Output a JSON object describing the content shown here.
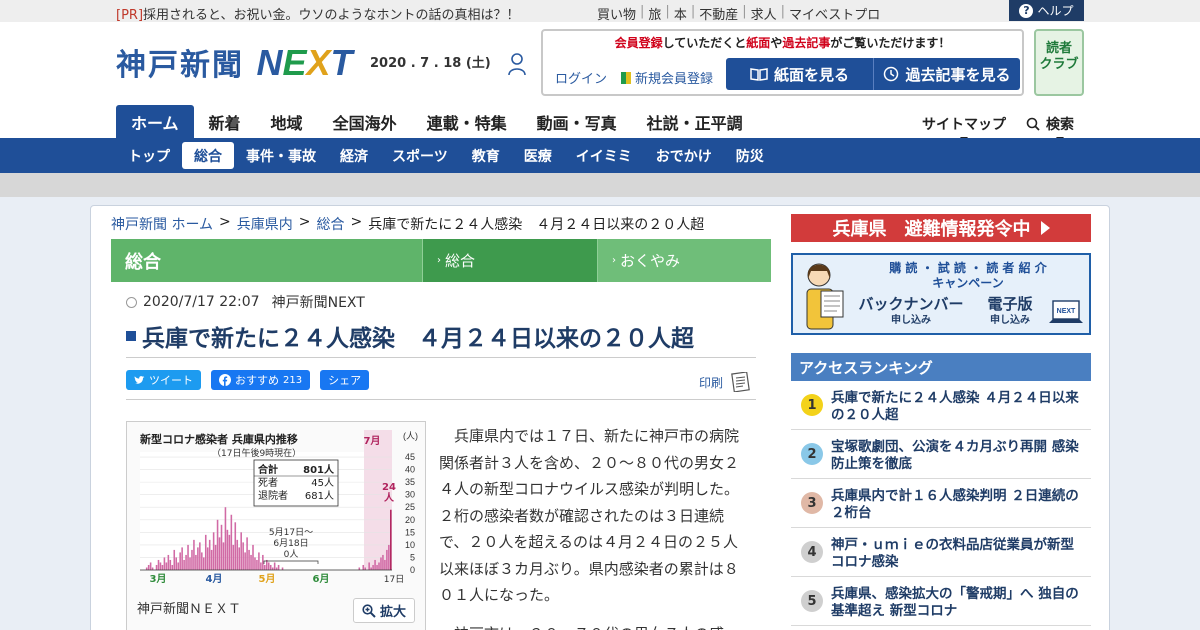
{
  "top_bar": {
    "pr_tag": "[PR]",
    "pr_text": "採用されると、お祝い金。ウソのようなホントの話の真相は？！",
    "links": [
      "買い物",
      "旅",
      "本",
      "不動産",
      "求人",
      "マイベストプロ"
    ],
    "help_label": "ヘルプ"
  },
  "header": {
    "logo_jp": "神戸新聞",
    "logo_next": [
      "N",
      "E",
      "X",
      "T"
    ],
    "date": "2020 . 7 . 18 (土)",
    "member_msg_parts": [
      "会員登録",
      "していただくと",
      "紙面",
      "や",
      "過去記事",
      "がご覧いただけます！"
    ],
    "login_label": "ログイン",
    "register_label": "新規会員登録",
    "view_paper_label": "紙面を見る",
    "past_articles_label": "過去記事を見る",
    "readers_club_line1": "読者",
    "readers_club_line2": "クラブ"
  },
  "main_nav": {
    "items": [
      "ホーム",
      "新着",
      "地域",
      "全国海外",
      "連載・特集",
      "動画・写真",
      "社説・正平調"
    ],
    "sitemap_label": "サイトマップ",
    "search_label": "検索"
  },
  "sub_nav": {
    "items": [
      "トップ",
      "総合",
      "事件・事故",
      "経済",
      "スポーツ",
      "教育",
      "医療",
      "イイミミ",
      "おでかけ",
      "防災"
    ]
  },
  "breadcrumb": [
    "神戸新聞 ホーム",
    "兵庫県内",
    "総合",
    "兵庫で新たに２４人感染　４月２４日以来の２０人超"
  ],
  "category": {
    "title": "総合",
    "tabs": [
      "総合",
      "おくやみ"
    ]
  },
  "article": {
    "datetime": "2020/7/17 22:07",
    "source": "神戸新聞NEXT",
    "headline": "兵庫で新たに２４人感染　４月２４日以来の２０人超",
    "tweet_label": "ツイート",
    "fb_label": "おすすめ",
    "fb_count": "213",
    "fb_share_label": "シェア",
    "print_label": "印刷",
    "paragraphs": [
      "兵庫県内では１７日、新たに神戸市の病院関係者計３人を含め、２０～８０代の男女２４人の新型コロナウイルス感染が判明した。２桁の感染者数が確認されたのは３日連続で、２０人を超えるのは４月２４日の２５人以来ほぼ３カ月ぶり。県内感染者の累計は８０１人になった。",
      "神戸市は、２０～７０代の男女７人の感"
    ],
    "figure_caption": "神戸新聞ＮＥＸＴ",
    "zoom_label": "拡大"
  },
  "chart_data": {
    "type": "bar",
    "title": "新型コロナ感染者 兵庫県内推移",
    "subtitle": "（17日午後9時現在）",
    "summary": [
      {
        "label": "合計",
        "value": "801人"
      },
      {
        "label": "死者",
        "value": "45人"
      },
      {
        "label": "退院者",
        "value": "681人"
      }
    ],
    "unit": "(人)",
    "y_ticks": [
      "45",
      "40",
      "35",
      "30",
      "25",
      "20",
      "15",
      "10",
      "5",
      "0"
    ],
    "ylim": [
      0,
      47
    ],
    "month_labels": [
      "3月",
      "4月",
      "5月",
      "6月",
      "7月"
    ],
    "last_label": "17日",
    "annotation": "5月17日～\n6月18日\n0人",
    "highlight_label": "24\n人",
    "values": [
      0,
      0,
      0,
      1,
      2,
      3,
      1,
      0,
      2,
      4,
      3,
      2,
      5,
      3,
      6,
      4,
      2,
      8,
      5,
      3,
      7,
      9,
      4,
      6,
      10,
      5,
      8,
      12,
      6,
      9,
      11,
      7,
      5,
      14,
      9,
      12,
      8,
      15,
      10,
      20,
      13,
      18,
      11,
      25,
      16,
      14,
      22,
      10,
      19,
      12,
      9,
      15,
      11,
      7,
      13,
      8,
      6,
      10,
      5,
      4,
      7,
      3,
      6,
      2,
      4,
      3,
      2,
      1,
      3,
      1,
      2,
      0,
      1,
      0,
      0,
      0,
      0,
      0,
      0,
      0,
      0,
      0,
      0,
      0,
      0,
      0,
      0,
      0,
      0,
      0,
      0,
      0,
      0,
      0,
      0,
      0,
      0,
      0,
      0,
      0,
      0,
      0,
      0,
      0,
      0,
      0,
      0,
      0,
      0,
      0,
      0,
      1,
      0,
      2,
      1,
      0,
      3,
      1,
      2,
      4,
      2,
      3,
      5,
      6,
      4,
      8,
      10,
      24
    ],
    "series_color": "#d16aa5",
    "highlight_color": "#b0245e"
  },
  "right_column": {
    "evac_banner": "兵庫県　避難情報発令中",
    "promo_title_line1": "購 読 ・ 試 読 ・ 読 者 紹 介",
    "promo_title_line2": "キャンペーン",
    "promo_backnumber": "バックナンバー",
    "promo_backnumber_sub": "申し込み",
    "promo_ebook": "電子版",
    "promo_ebook_sub": "申し込み",
    "promo_ebook_badge": "NEXT",
    "ranking_title": "アクセスランキング",
    "ranking": [
      {
        "rank": "1",
        "title": "兵庫で新たに２４人感染 ４月２４日以来の２０人超",
        "color": "#f3d21a"
      },
      {
        "rank": "2",
        "title": "宝塚歌劇団、公演を４カ月ぶり再開 感染防止策を徹底",
        "color": "#8ac8e8"
      },
      {
        "rank": "3",
        "title": "兵庫県内で計１６人感染判明 ２日連続の２桁台",
        "color": "#e0b8a6"
      },
      {
        "rank": "4",
        "title": "神戸・ｕｍｉｅの衣料品店従業員が新型コロナ感染",
        "color": "#cfcfcf"
      },
      {
        "rank": "5",
        "title": "兵庫県、感染拡大の「警戒期」へ 独自の基準超え 新型コロナ",
        "color": "#cfcfcf"
      }
    ]
  }
}
